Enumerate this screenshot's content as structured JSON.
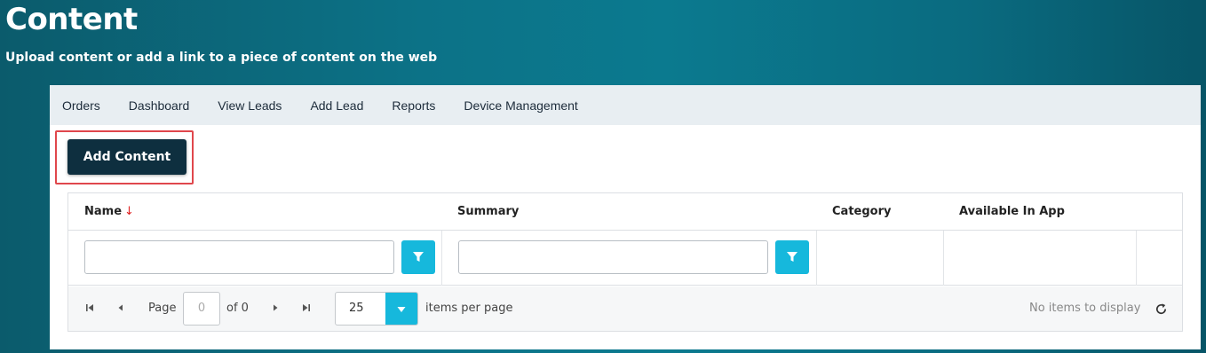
{
  "header": {
    "title": "Content",
    "subtitle": "Upload content or add a link to a piece of content on the web"
  },
  "nav": {
    "items": [
      "Orders",
      "Dashboard",
      "View Leads",
      "Add Lead",
      "Reports",
      "Device Management"
    ]
  },
  "toolbar": {
    "add_content_label": "Add Content"
  },
  "grid": {
    "columns": [
      "Name",
      "Summary",
      "Category",
      "Available In App"
    ],
    "sort_indicator": "↓",
    "filters": {
      "name_value": "",
      "summary_value": ""
    }
  },
  "pager": {
    "page_label": "Page",
    "page_value": "0",
    "of_label": "of 0",
    "per_page_value": "25",
    "per_page_label": "items per page",
    "status": "No items to display"
  },
  "colors": {
    "accent": "#16b8dc",
    "primary_button": "#0e2f3f",
    "highlight": "#e0474c"
  }
}
